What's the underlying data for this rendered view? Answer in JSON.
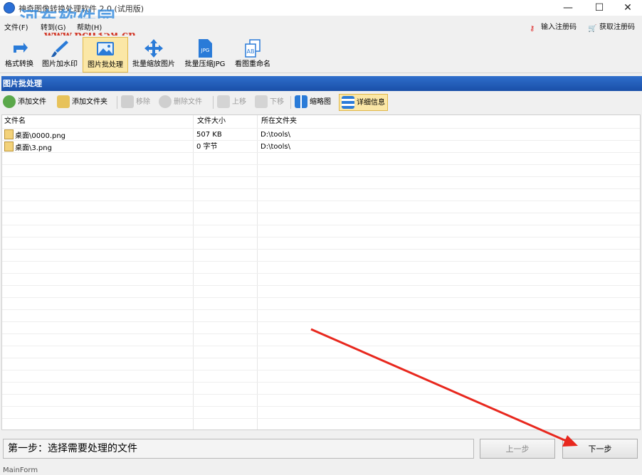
{
  "titlebar": {
    "title": "神奇图像转换处理软件 2.0 (试用版)",
    "minimize": "—",
    "maximize": "☐",
    "close": "✕"
  },
  "watermark": {
    "name": "河东软件园",
    "url": "www.pc0359.cn"
  },
  "menu": {
    "items": [
      "文件(F)",
      "转到(G)",
      "帮助(H)"
    ],
    "register_label": "输入注册码",
    "get_code_label": "获取注册码"
  },
  "toolbar": {
    "tools": [
      {
        "label": "格式转换",
        "icon": "rotate-icon"
      },
      {
        "label": "图片加水印",
        "icon": "brush-icon"
      },
      {
        "label": "图片批处理",
        "icon": "image-icon"
      },
      {
        "label": "批量缩放图片",
        "icon": "move-arrows-icon"
      },
      {
        "label": "批量压缩JPG",
        "icon": "jpg-file-icon"
      },
      {
        "label": "看图重命名",
        "icon": "rename-icon"
      }
    ],
    "jpg_badge": "JPG",
    "rename_badge": "AB"
  },
  "section": {
    "title": "图片批处理"
  },
  "subtoolbar": {
    "add_file": "添加文件",
    "add_folder": "添加文件夹",
    "remove": "移除",
    "delete_file": "删除文件",
    "move_up": "上移",
    "move_down": "下移",
    "thumbnail": "缩略图",
    "details": "详细信息"
  },
  "table": {
    "columns": [
      "文件名",
      "文件大小",
      "所在文件夹"
    ],
    "rows": [
      {
        "name": "桌面\\0000.png",
        "size": "507 KB",
        "folder": "D:\\tools\\"
      },
      {
        "name": "桌面\\3.png",
        "size": "0 字节",
        "folder": "D:\\tools\\"
      }
    ]
  },
  "footer": {
    "step_text": "第一步：选择需要处理的文件",
    "prev_label": "上一步",
    "next_label": "下一步",
    "form_name": "MainForm"
  },
  "colors": {
    "section_header": "#1a4fa8",
    "active_tool": "#fbe7a6",
    "arrow": "#e8281e"
  }
}
